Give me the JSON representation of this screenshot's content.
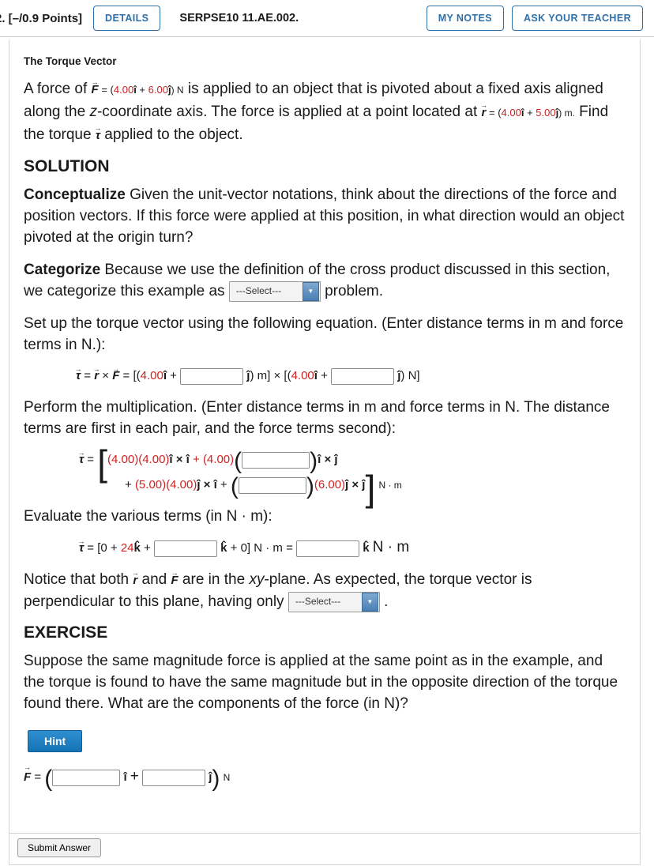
{
  "topbar": {
    "points": "2. [–/0.9 Points]",
    "details_label": "DETAILS",
    "exercise_id": "SERPSE10 11.AE.002.",
    "my_notes_label": "MY NOTES",
    "ask_teacher_label": "ASK YOUR TEACHER"
  },
  "content": {
    "section_title": "The Torque Vector",
    "problem": {
      "p1_a": "A force of ",
      "f_vec": "F",
      "f_eq": " = (",
      "f_val1": "4.00",
      "f_hat1": "i",
      "f_plus": " + ",
      "f_val2": "6.00",
      "f_hat2": "j",
      "f_close": ") N",
      "p1_b": " is applied to an object that is pivoted about a fixed axis aligned along the ",
      "z_italic": "z",
      "p1_c": "-coordinate axis. The force is applied at a point located at ",
      "r_vec": "r",
      "r_eq": " = (",
      "r_val1": "4.00",
      "r_hat1": "i",
      "r_plus": " + ",
      "r_val2": "5.00",
      "r_hat2": "j",
      "r_close": ") m.",
      "p1_d": " Find the torque ",
      "tau_vec": "τ",
      "p1_e": " applied to the object."
    },
    "solution_heading": "SOLUTION",
    "conceptualize": {
      "label": "Conceptualize",
      "text": " Given the unit-vector notations, think about the directions of the force and position vectors. If this force were applied at this position, in what direction would an object pivoted at the origin turn?"
    },
    "categorize": {
      "label": "Categorize",
      "text_a": " Because we use the definition of the cross product discussed in this section, we categorize this example as ",
      "select_value": "---Select---",
      "text_b": " problem."
    },
    "setup_text": "Set up the torque vector using the following equation. (Enter distance terms in m and force terms in N.):",
    "eq1": {
      "tau": "τ",
      "eq": " = ",
      "r": "r",
      "cross": "×",
      "f": "F",
      "eq2": " = [(",
      "v1": "4.00",
      "hat1": "i",
      "plus1": " + ",
      "input1": "",
      "hat2": "j",
      "close1": ") m] ",
      "times": "×",
      "open2": " [(",
      "v2": "4.00",
      "hat3": "i",
      "plus2": " + ",
      "input2": "",
      "hat4": "j",
      "close2": ") N]"
    },
    "multiply_text": "Perform the multiplication. (Enter distance terms in m and force terms in N. The distance terms are first in each pair, and the force terms second):",
    "eq2": {
      "tau": "τ",
      "eq": " = ",
      "a1": "(4.00)",
      "a2": "(4.00)",
      "hat_ii": "i × i",
      "a3": " + (4.00)",
      "input1": "",
      "hat_ij": "i × j",
      "row2_plus": "+ ",
      "b1": "(5.00)",
      "b2": "(4.00)",
      "hat_ji": "j × i",
      "b3": " + ",
      "input2": "",
      "b4": "(6.00)",
      "hat_jj": "j × j",
      "unit": "N · m"
    },
    "evaluate_text": "Evaluate the various terms (in N · m):",
    "eq3": {
      "tau": "τ",
      "eq": " = [0 + ",
      "v24": "24",
      "khat1": "k",
      "plus": " + ",
      "input1": "",
      "khat2": "k",
      "zero": " + 0] N · m = ",
      "input2": "",
      "khat3": "k",
      "unit": "N · m"
    },
    "notice": {
      "a": "Notice that both ",
      "r": "r",
      "b": " and ",
      "f": "F",
      "c": " are in the ",
      "xy": "xy",
      "d": "-plane. As expected, the torque vector is perpendicular to this plane, having only ",
      "select_value": "---Select---",
      "e": " ."
    },
    "exercise_heading": "EXERCISE",
    "exercise_text": "Suppose the same magnitude force is applied at the same point as in the example, and the torque is found to have the same magnitude but in the opposite direction of the torque found there. What are the components of the force (in N)?",
    "hint_label": "Hint",
    "final": {
      "f": "F",
      "eq": " = ",
      "input1": "",
      "hat_i": "i",
      "plus": "+",
      "input2": "",
      "hat_j": "j",
      "unit": "N"
    }
  },
  "footer": {
    "submit_label": "Submit Answer"
  }
}
